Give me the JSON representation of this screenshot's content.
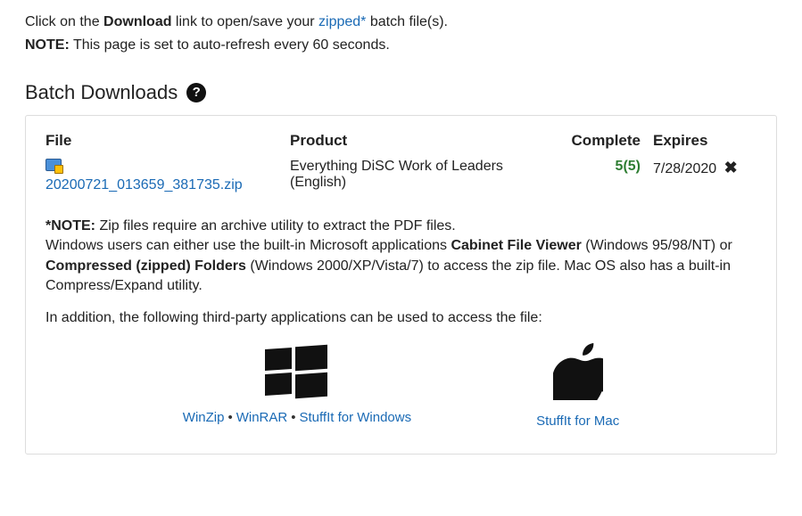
{
  "intro": {
    "prefix": "Click on the ",
    "downloadWord": "Download",
    "mid": " link to open/save your ",
    "zippedLink": "zipped*",
    "suffix": " batch file(s)."
  },
  "noteLine": {
    "label": "NOTE:",
    "text": " This page is set to auto-refresh every 60 seconds."
  },
  "section": {
    "title": "Batch Downloads"
  },
  "table": {
    "headers": {
      "file": "File",
      "product": "Product",
      "complete": "Complete",
      "expires": "Expires"
    },
    "row": {
      "filename": "20200721_013659_381735.zip",
      "product": "Everything DiSC Work of Leaders (English)",
      "complete": "5(5)",
      "expires": "7/28/2020"
    }
  },
  "note": {
    "label": "*NOTE:",
    "l1": " Zip files require an archive utility to extract the PDF files.",
    "l2a": "Windows users can either use the built-in Microsoft applications ",
    "cfv": "Cabinet File Viewer",
    "l2b": " (Windows 95/98/NT) or ",
    "czf": "Compressed (zipped) Folders",
    "l2c": " (Windows 2000/XP/Vista/7) to access the zip file. Mac OS also has a built-in Compress/Expand utility.",
    "l3": "In addition, the following third-party applications can be used to access the file:"
  },
  "apps": {
    "win": {
      "winzip": "WinZip",
      "winrar": "WinRAR",
      "stuffit": "StuffIt for Windows"
    },
    "mac": {
      "stuffit": "StuffIt for Mac"
    }
  }
}
